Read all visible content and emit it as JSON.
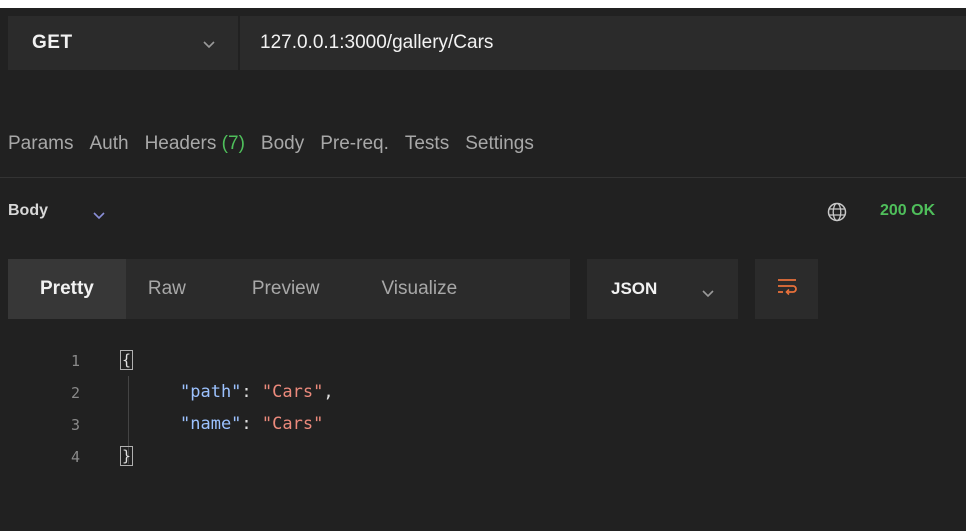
{
  "request": {
    "method": "GET",
    "url": "127.0.0.1:3000/gallery/Cars"
  },
  "request_tabs": [
    {
      "label": "Params"
    },
    {
      "label": "Auth"
    },
    {
      "label": "Headers",
      "count": "(7)"
    },
    {
      "label": "Body"
    },
    {
      "label": "Pre-req."
    },
    {
      "label": "Tests"
    },
    {
      "label": "Settings"
    }
  ],
  "response": {
    "section_label": "Body",
    "status": "200 OK",
    "view_modes": [
      "Pretty",
      "Raw",
      "Preview",
      "Visualize"
    ],
    "active_view": "Pretty",
    "format": "JSON"
  },
  "code": {
    "line_numbers": [
      "1",
      "2",
      "3",
      "4"
    ],
    "open_brace": "{",
    "close_brace": "}",
    "line2_key": "\"path\"",
    "line2_value": "\"Cars\"",
    "line3_key": "\"name\"",
    "line3_value": "\"Cars\""
  },
  "icons": {
    "method_dropdown": "chevron-down-icon",
    "body_dropdown": "chevron-down-icon",
    "network": "globe-icon",
    "format_dropdown": "chevron-down-icon",
    "wrap": "wrap-lines-icon"
  },
  "colors": {
    "background": "#212121",
    "panel": "#2b2b2b",
    "success": "#4fbf5b",
    "accent": "#e8703a",
    "json_key": "#9cc2ff",
    "json_string": "#ec8a7c"
  }
}
